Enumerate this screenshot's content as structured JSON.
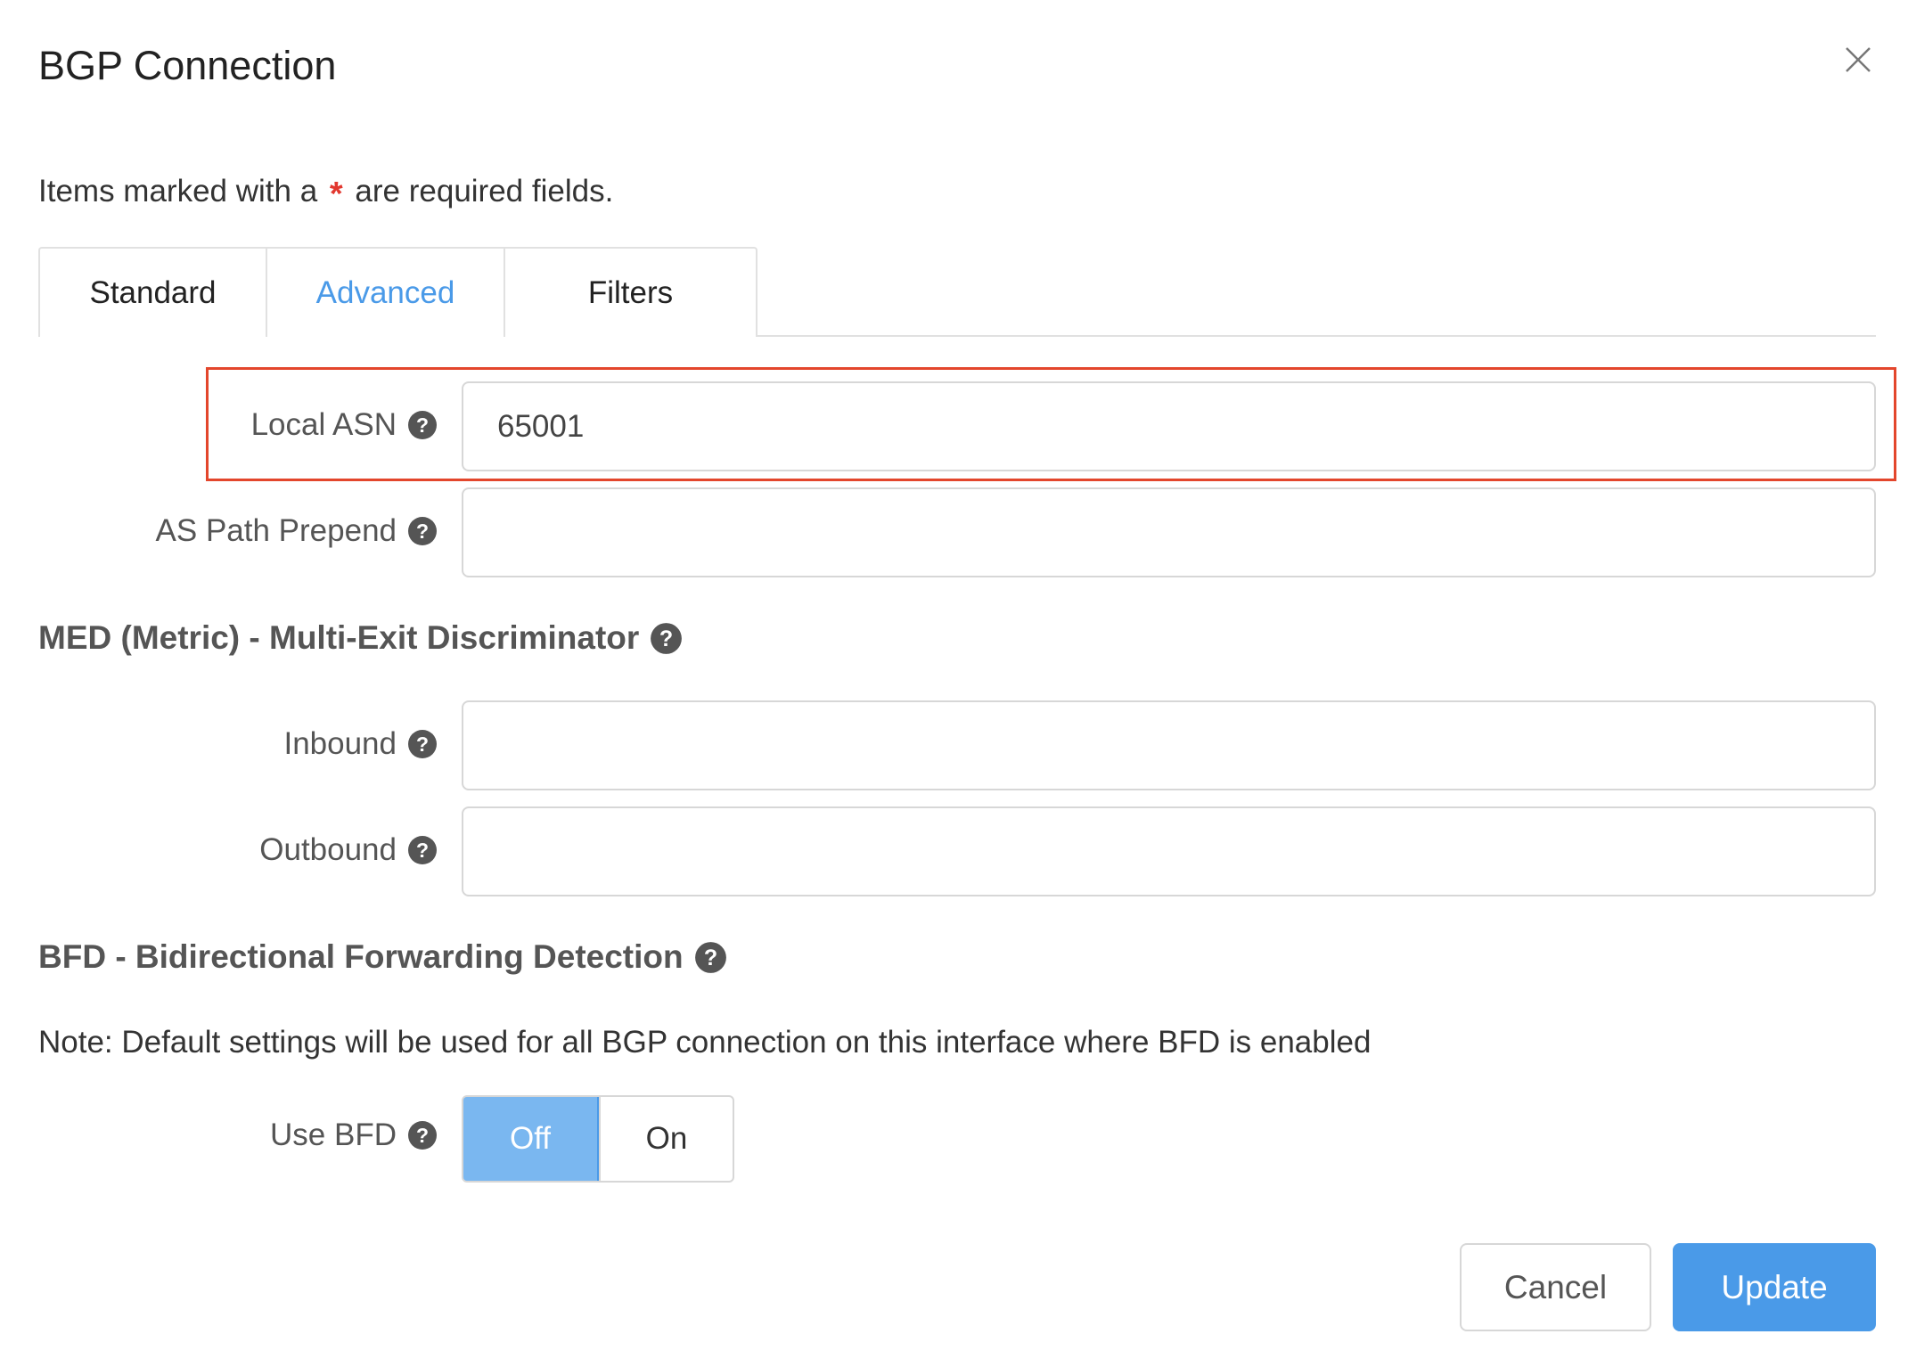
{
  "dialog": {
    "title": "BGP Connection",
    "close_icon": "close-icon"
  },
  "required_note": {
    "prefix": "Items marked with a",
    "star": "*",
    "suffix": "are required fields."
  },
  "tabs": [
    {
      "label": "Standard",
      "active": false
    },
    {
      "label": "Advanced",
      "active": true
    },
    {
      "label": "Filters",
      "active": false
    }
  ],
  "fields": {
    "local_asn": {
      "label": "Local ASN",
      "value": "65001"
    },
    "as_path_prepend": {
      "label": "AS Path Prepend",
      "value": ""
    },
    "inbound": {
      "label": "Inbound",
      "value": ""
    },
    "outbound": {
      "label": "Outbound",
      "value": ""
    }
  },
  "sections": {
    "med": "MED (Metric) - Multi-Exit Discriminator",
    "bfd": "BFD - Bidirectional Forwarding Detection"
  },
  "bfd_note": "Note: Default settings will be used for all BGP connection on this interface where BFD is enabled",
  "use_bfd": {
    "label": "Use BFD",
    "options": [
      "Off",
      "On"
    ],
    "selected": "Off"
  },
  "buttons": {
    "cancel": "Cancel",
    "update": "Update"
  },
  "colors": {
    "accent": "#4a9ae8",
    "toggle_selected": "#7ab7f0",
    "required_star": "#e2382f",
    "highlight_box": "#e3462c"
  },
  "icons": {
    "help": "question-circle-icon",
    "close": "close-icon"
  }
}
